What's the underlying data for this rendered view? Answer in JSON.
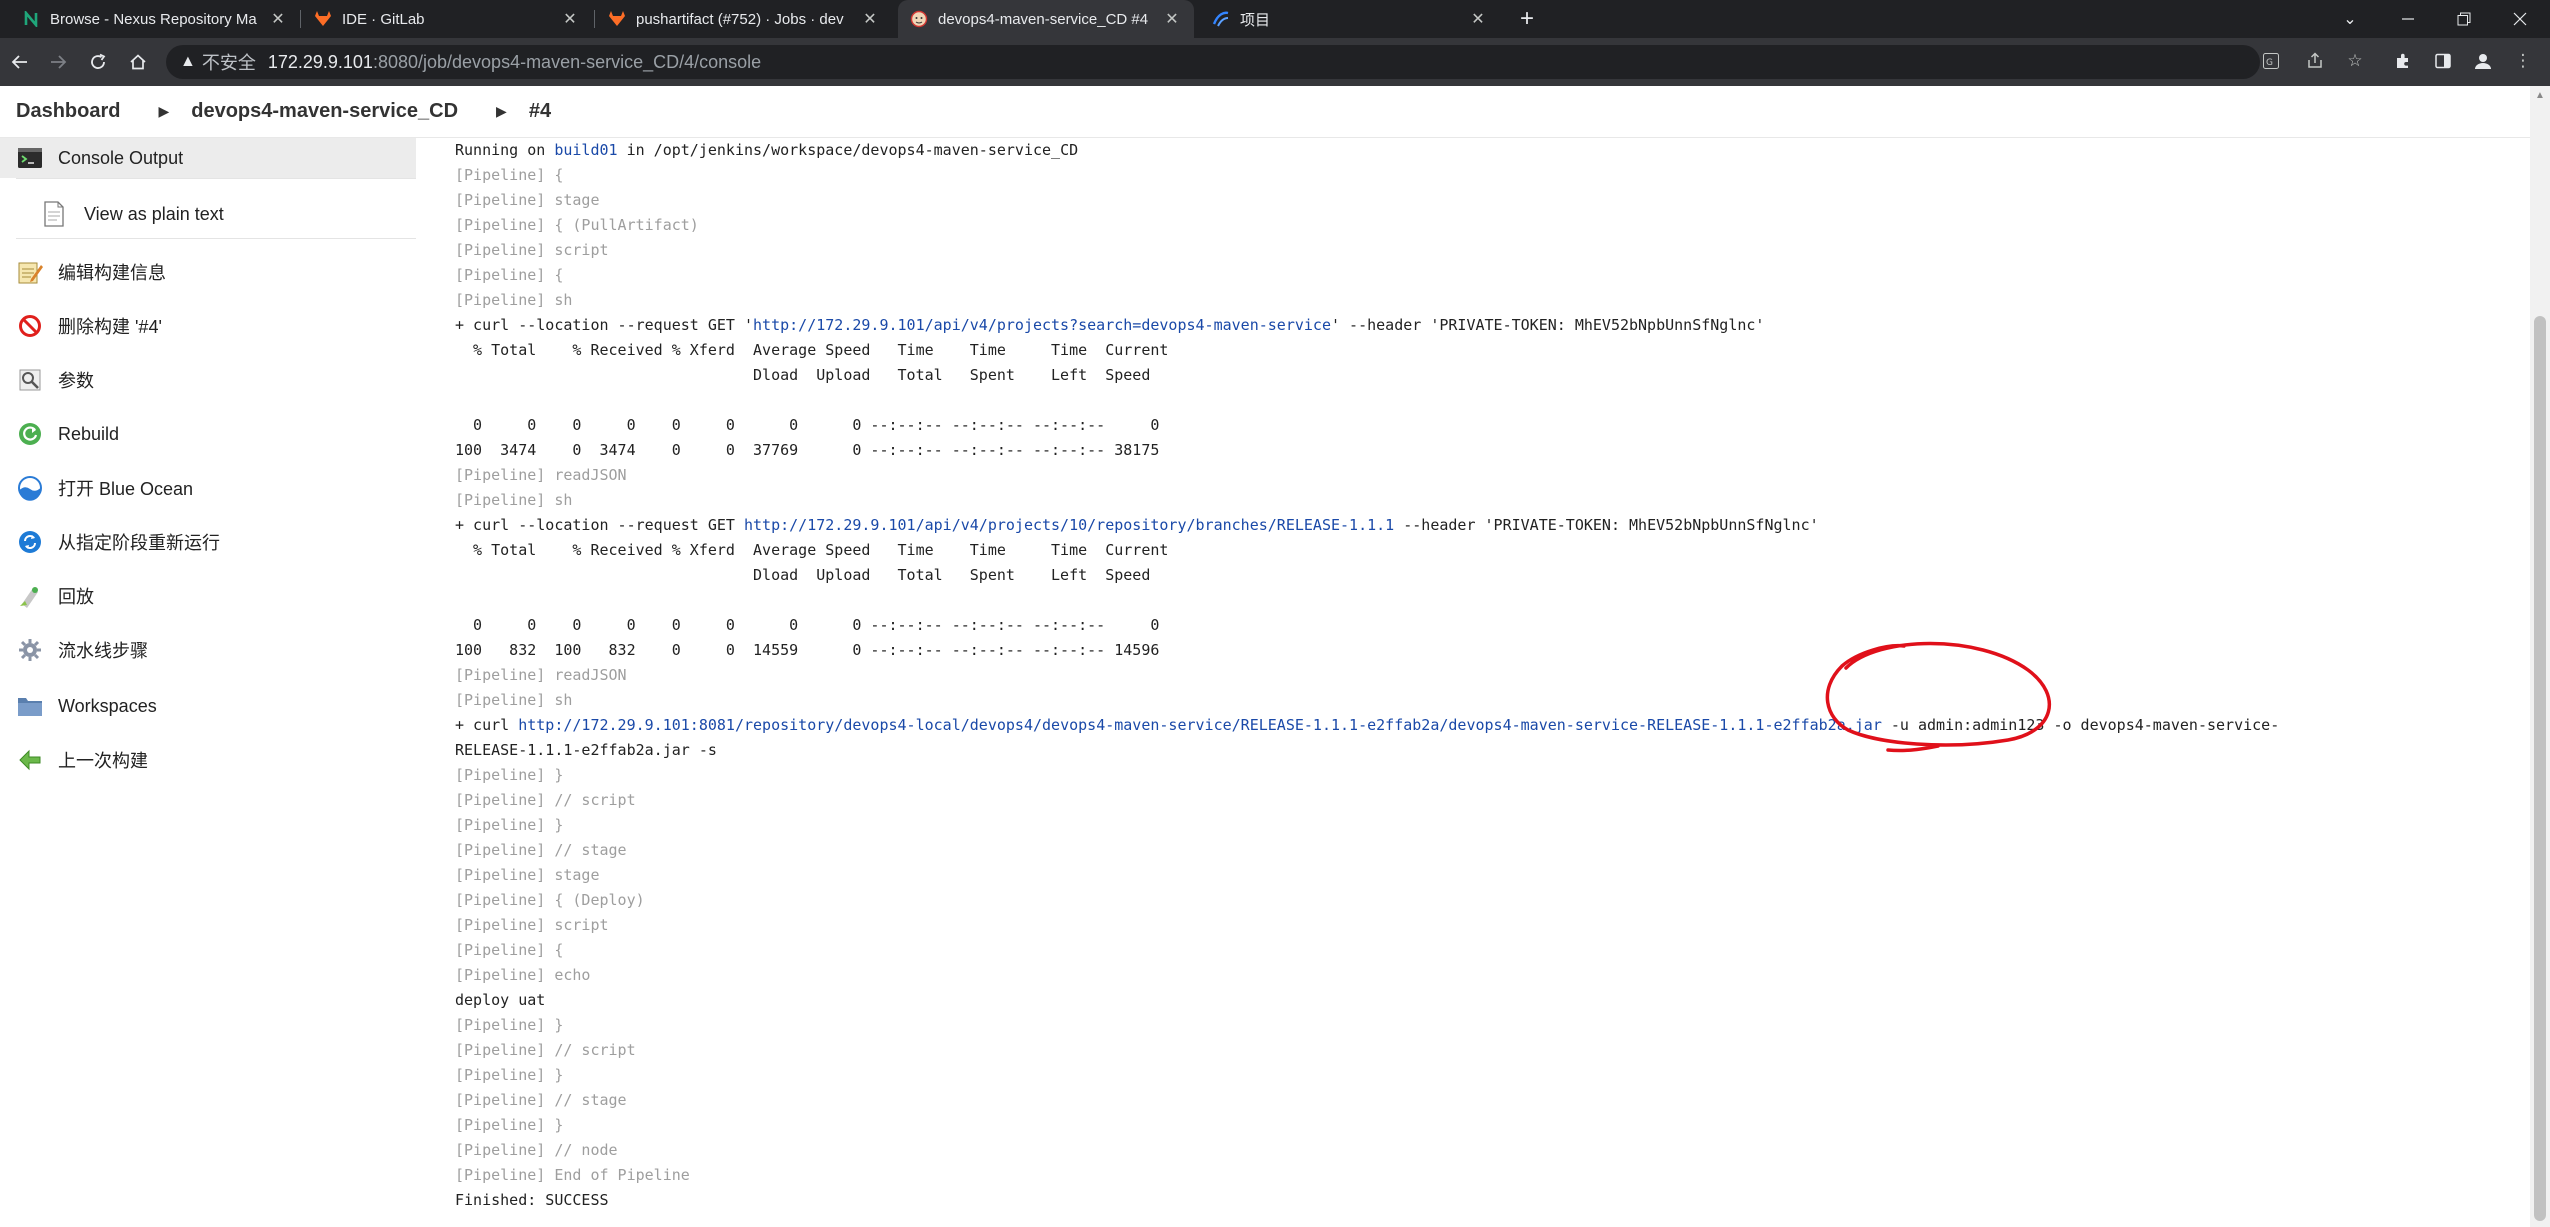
{
  "browser": {
    "tabs": [
      {
        "title": "Browse - Nexus Repository Ma",
        "icon": "nexus-icon",
        "color": "#1fa67a"
      },
      {
        "title": "IDE · GitLab",
        "icon": "gitlab-icon",
        "color": "#fc6d26"
      },
      {
        "title": "pushartifact (#752) · Jobs · dev",
        "icon": "gitlab-icon",
        "color": "#fc6d26"
      },
      {
        "title": "devops4-maven-service_CD #4",
        "icon": "jenkins-icon",
        "color": "#d33833"
      },
      {
        "title": "项目",
        "icon": "kubesphere-icon",
        "color": "#3385ff"
      }
    ],
    "active_tab": 3,
    "new_tab": "+",
    "address": {
      "insecure_label": "不安全",
      "host": "172.29.9.101",
      "path": ":8080/job/devops4-maven-service_CD/4/console"
    }
  },
  "breadcrumb": {
    "items": [
      "Dashboard",
      "devops4-maven-service_CD",
      "#4"
    ]
  },
  "sidebar": {
    "items": [
      {
        "label": "Console Output",
        "icon": "terminal-icon",
        "active": true
      },
      {
        "label": "View as plain text",
        "icon": "document-icon",
        "sub": true
      },
      {
        "label": "编辑构建信息",
        "icon": "notepad-icon"
      },
      {
        "label": "删除构建 '#4'",
        "icon": "delete-icon"
      },
      {
        "label": "参数",
        "icon": "parameters-icon"
      },
      {
        "label": "Rebuild",
        "icon": "rebuild-icon"
      },
      {
        "label": "打开 Blue Ocean",
        "icon": "blue-ocean-icon"
      },
      {
        "label": "从指定阶段重新运行",
        "icon": "restart-stage-icon"
      },
      {
        "label": "回放",
        "icon": "replay-icon"
      },
      {
        "label": "流水线步骤",
        "icon": "pipeline-steps-icon"
      },
      {
        "label": "Workspaces",
        "icon": "folder-icon"
      },
      {
        "label": "上一次构建",
        "icon": "previous-build-icon"
      }
    ]
  },
  "console": {
    "lines": [
      {
        "parts": [
          {
            "t": "Running on "
          },
          {
            "t": "build01",
            "link": true
          },
          {
            "t": " in /opt/jenkins/workspace/devops4-maven-service_CD"
          }
        ]
      },
      {
        "pipe": true,
        "parts": [
          {
            "t": "[Pipeline] {"
          }
        ]
      },
      {
        "pipe": true,
        "parts": [
          {
            "t": "[Pipeline] stage"
          }
        ]
      },
      {
        "pipe": true,
        "parts": [
          {
            "t": "[Pipeline] { (PullArtifact)"
          }
        ]
      },
      {
        "pipe": true,
        "parts": [
          {
            "t": "[Pipeline] script"
          }
        ]
      },
      {
        "pipe": true,
        "parts": [
          {
            "t": "[Pipeline] {"
          }
        ]
      },
      {
        "pipe": true,
        "parts": [
          {
            "t": "[Pipeline] sh"
          }
        ]
      },
      {
        "parts": [
          {
            "t": "+ curl --location --request GET '"
          },
          {
            "t": "http://172.29.9.101/api/v4/projects?search=devops4-maven-service",
            "link": true
          },
          {
            "t": "' --header 'PRIVATE-TOKEN: MhEV52bNpbUnnSfNglnc'"
          }
        ]
      },
      {
        "parts": [
          {
            "t": "  % Total    % Received % Xferd  Average Speed   Time    Time     Time  Current"
          }
        ]
      },
      {
        "parts": [
          {
            "t": "                                 Dload  Upload   Total   Spent    Left  Speed"
          }
        ]
      },
      {
        "parts": [
          {
            "t": ""
          }
        ]
      },
      {
        "parts": [
          {
            "t": "  0     0    0     0    0     0      0      0 --:--:-- --:--:-- --:--:--     0"
          }
        ]
      },
      {
        "parts": [
          {
            "t": "100  3474    0  3474    0     0  37769      0 --:--:-- --:--:-- --:--:-- 38175"
          }
        ]
      },
      {
        "pipe": true,
        "parts": [
          {
            "t": "[Pipeline] readJSON"
          }
        ]
      },
      {
        "pipe": true,
        "parts": [
          {
            "t": "[Pipeline] sh"
          }
        ]
      },
      {
        "parts": [
          {
            "t": "+ curl --location --request GET "
          },
          {
            "t": "http://172.29.9.101/api/v4/projects/10/repository/branches/RELEASE-1.1.1",
            "link": true
          },
          {
            "t": " --header 'PRIVATE-TOKEN: MhEV52bNpbUnnSfNglnc'"
          }
        ]
      },
      {
        "parts": [
          {
            "t": "  % Total    % Received % Xferd  Average Speed   Time    Time     Time  Current"
          }
        ]
      },
      {
        "parts": [
          {
            "t": "                                 Dload  Upload   Total   Spent    Left  Speed"
          }
        ]
      },
      {
        "parts": [
          {
            "t": ""
          }
        ]
      },
      {
        "parts": [
          {
            "t": "  0     0    0     0    0     0      0      0 --:--:-- --:--:-- --:--:--     0"
          }
        ]
      },
      {
        "parts": [
          {
            "t": "100   832  100   832    0     0  14559      0 --:--:-- --:--:-- --:--:-- 14596"
          }
        ]
      },
      {
        "pipe": true,
        "parts": [
          {
            "t": "[Pipeline] readJSON"
          }
        ]
      },
      {
        "pipe": true,
        "parts": [
          {
            "t": "[Pipeline] sh"
          }
        ]
      },
      {
        "parts": [
          {
            "t": "+ curl "
          },
          {
            "t": "http://172.29.9.101:8081/repository/devops4-local/devops4/devops4-maven-service/RELEASE-1.1.1-e2ffab2a/devops4-maven-service-RELEASE-1.1.1-e2ffab2a.jar",
            "link": true
          },
          {
            "t": " -u admin:admin123 -o devops4-maven-service-"
          }
        ]
      },
      {
        "parts": [
          {
            "t": "RELEASE-1.1.1-e2ffab2a.jar -s"
          }
        ]
      },
      {
        "pipe": true,
        "parts": [
          {
            "t": "[Pipeline] }"
          }
        ]
      },
      {
        "pipe": true,
        "parts": [
          {
            "t": "[Pipeline] // script"
          }
        ]
      },
      {
        "pipe": true,
        "parts": [
          {
            "t": "[Pipeline] }"
          }
        ]
      },
      {
        "pipe": true,
        "parts": [
          {
            "t": "[Pipeline] // stage"
          }
        ]
      },
      {
        "pipe": true,
        "parts": [
          {
            "t": "[Pipeline] stage"
          }
        ]
      },
      {
        "pipe": true,
        "parts": [
          {
            "t": "[Pipeline] { (Deploy)"
          }
        ]
      },
      {
        "pipe": true,
        "parts": [
          {
            "t": "[Pipeline] script"
          }
        ]
      },
      {
        "pipe": true,
        "parts": [
          {
            "t": "[Pipeline] {"
          }
        ]
      },
      {
        "pipe": true,
        "parts": [
          {
            "t": "[Pipeline] echo"
          }
        ]
      },
      {
        "parts": [
          {
            "t": "deploy uat"
          }
        ]
      },
      {
        "pipe": true,
        "parts": [
          {
            "t": "[Pipeline] }"
          }
        ]
      },
      {
        "pipe": true,
        "parts": [
          {
            "t": "[Pipeline] // script"
          }
        ]
      },
      {
        "pipe": true,
        "parts": [
          {
            "t": "[Pipeline] }"
          }
        ]
      },
      {
        "pipe": true,
        "parts": [
          {
            "t": "[Pipeline] // stage"
          }
        ]
      },
      {
        "pipe": true,
        "parts": [
          {
            "t": "[Pipeline] }"
          }
        ]
      },
      {
        "pipe": true,
        "parts": [
          {
            "t": "[Pipeline] // node"
          }
        ]
      },
      {
        "pipe": true,
        "parts": [
          {
            "t": "[Pipeline] End of Pipeline"
          }
        ]
      },
      {
        "parts": [
          {
            "t": "Finished: SUCCESS"
          }
        ]
      }
    ]
  },
  "colors": {
    "link": "#1a49a8",
    "pipeline_text": "#9e9e9e",
    "annotation": "#e0101a"
  }
}
